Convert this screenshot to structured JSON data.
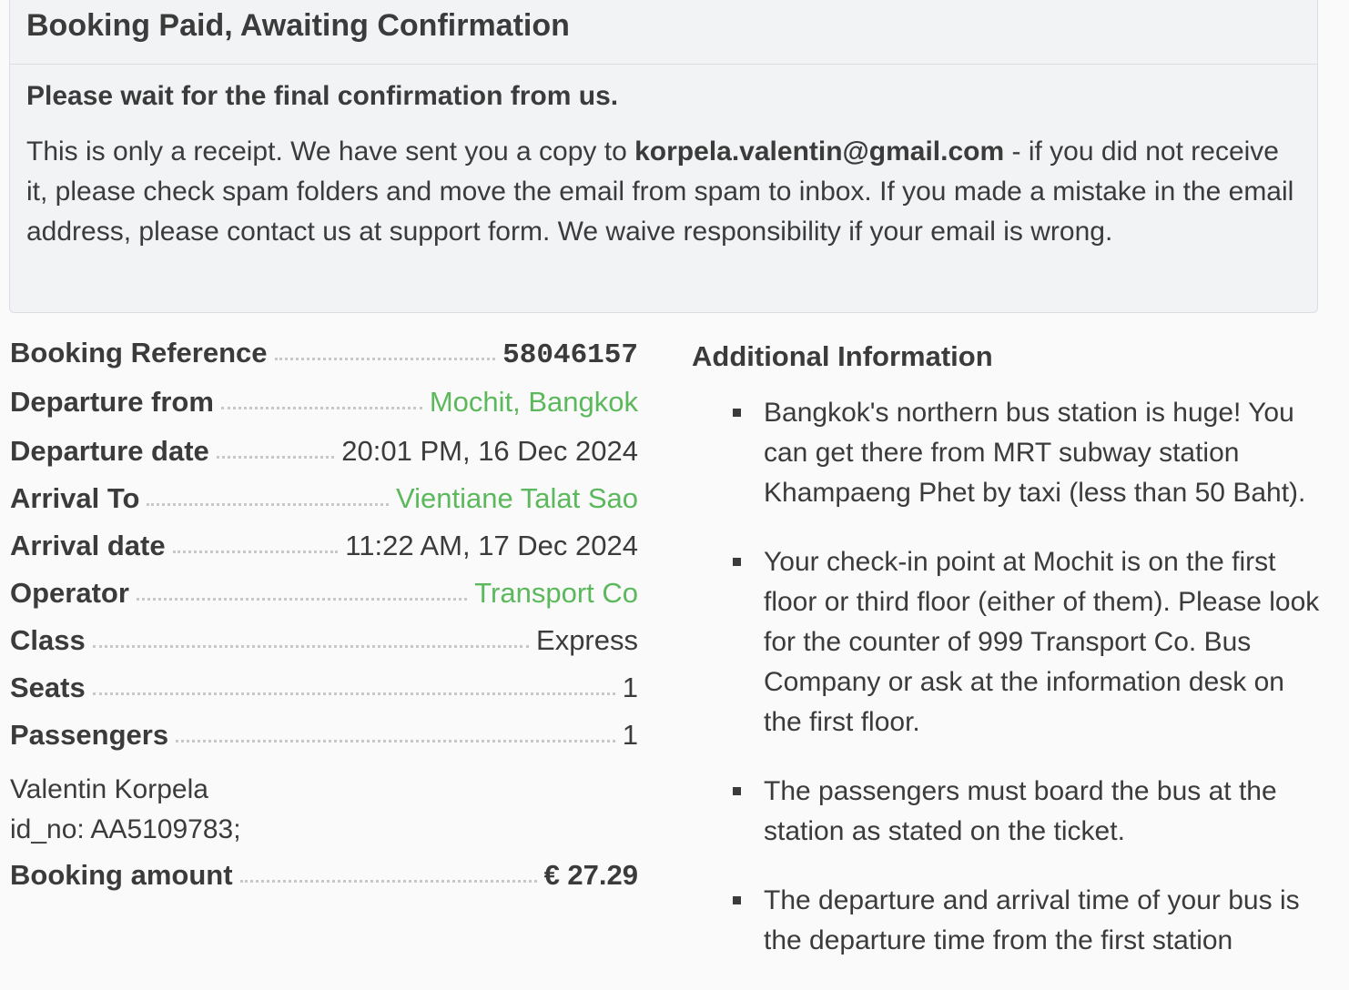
{
  "notice": {
    "title": "Booking Paid, Awaiting Confirmation",
    "subtitle": "Please wait for the final confirmation from us.",
    "text_before_email": "This is only a receipt. We have sent you a copy to ",
    "email": "korpela.valentin@gmail.com",
    "text_after_email": " - if you did not receive it, please check spam folders and move the email from spam to inbox. If you made a mistake in the email address, please contact us at support form. We waive responsibility if your email is wrong."
  },
  "details": {
    "booking_reference": {
      "label": "Booking Reference",
      "value": "58046157"
    },
    "departure_from": {
      "label": "Departure from",
      "value": "Mochit, Bangkok"
    },
    "departure_date": {
      "label": "Departure date",
      "value": "20:01 PM, 16 Dec 2024"
    },
    "arrival_to": {
      "label": "Arrival To",
      "value": "Vientiane Talat Sao"
    },
    "arrival_date": {
      "label": "Arrival date",
      "value": "11:22 AM, 17 Dec 2024"
    },
    "operator": {
      "label": "Operator",
      "value": "Transport Co"
    },
    "class": {
      "label": "Class",
      "value": "Express"
    },
    "seats": {
      "label": "Seats",
      "value": "1"
    },
    "passengers": {
      "label": "Passengers",
      "value": "1"
    },
    "passenger_name": "Valentin Korpela",
    "passenger_id": "id_no: AA5109783;",
    "booking_amount": {
      "label": "Booking amount",
      "value": "€ 27.29"
    }
  },
  "additional": {
    "title": "Additional Information",
    "items": [
      "Bangkok's northern bus station is huge! You can get there from MRT subway station Khampaeng Phet by taxi (less than 50 Baht).",
      "Your check-in point at Mochit is on the first floor or third floor (either of them). Please look for the counter of 999 Transport Co. Bus Company or ask at the information desk on the first floor.",
      "The passengers must board the bus at the station as stated on the ticket.",
      "The departure and arrival time of your bus is the departure time from the first station"
    ]
  },
  "colors": {
    "link_green": "#5cb85c",
    "text": "#3b3b3b",
    "notice_bg": "#f2f3f5"
  }
}
